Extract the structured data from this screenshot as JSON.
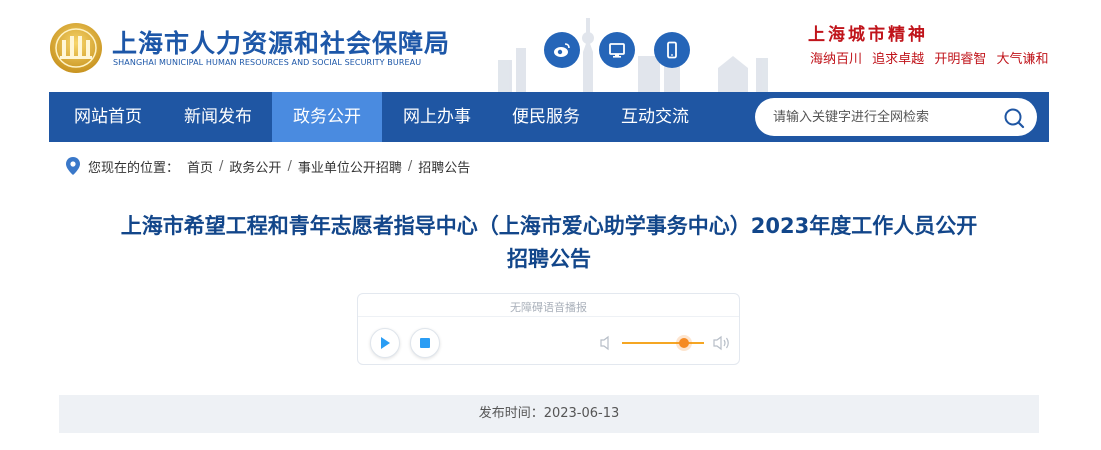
{
  "header": {
    "org_name_cn": "上海市人力资源和社会保障局",
    "org_name_en": "SHANGHAI MUNICIPAL HUMAN RESOURCES AND SOCIAL SECURITY BUREAU",
    "social_icons": [
      "weibo-icon",
      "desktop-icon",
      "mobile-icon"
    ],
    "slogan_title": "上海城市精神",
    "slogan_items": [
      "海纳百川",
      "追求卓越",
      "开明睿智",
      "大气谦和"
    ]
  },
  "nav": {
    "items": [
      {
        "label": "网站首页",
        "active": false
      },
      {
        "label": "新闻发布",
        "active": false
      },
      {
        "label": "政务公开",
        "active": true
      },
      {
        "label": "网上办事",
        "active": false
      },
      {
        "label": "便民服务",
        "active": false
      },
      {
        "label": "互动交流",
        "active": false
      }
    ],
    "search_placeholder": "请输入关键字进行全网检索"
  },
  "breadcrumb": {
    "prefix": "您现在的位置：",
    "items": [
      "首页",
      "政务公开",
      "事业单位公开招聘",
      "招聘公告"
    ]
  },
  "article": {
    "title_line1": "上海市希望工程和青年志愿者指导中心（上海市爱心助学事务中心）2023年度工作人员公开",
    "title_line2": "招聘公告",
    "publish_label": "发布时间：",
    "publish_date": "2023-06-13"
  },
  "player": {
    "label": "无障碍语音播报",
    "volume_level": 0.75
  },
  "colors": {
    "brand_blue": "#1f56a3",
    "nav_active": "#4a8be0",
    "title_blue": "#12468a",
    "slogan_red": "#c0141b",
    "volume_orange": "#f58a23"
  }
}
